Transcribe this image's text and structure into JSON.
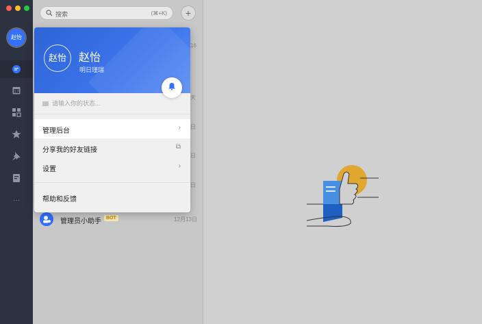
{
  "sidebar": {
    "avatar_text": "赵怡",
    "items": [
      {
        "name": "chat-icon",
        "active": true
      },
      {
        "name": "calendar-icon"
      },
      {
        "name": "apps-icon"
      },
      {
        "name": "star-icon"
      },
      {
        "name": "pin-icon"
      },
      {
        "name": "docs-icon"
      },
      {
        "name": "more-icon",
        "glyph": "···"
      }
    ]
  },
  "search": {
    "placeholder": "搜索",
    "hotkey": "(⌘+K)"
  },
  "list": {
    "bot_row": {
      "avatar": "",
      "name": "管理员小助手",
      "badge": "BOT",
      "time": "12月13日"
    },
    "partial_labels": [
      "16",
      "天",
      "日",
      "日",
      "日"
    ]
  },
  "profile_popup": {
    "avatar_text": "赵怡",
    "name": "赵怡",
    "org": "明日瑾瑞",
    "status_placeholder": "请输入你的状态...",
    "menu": [
      {
        "label": "管理后台",
        "tail": "›",
        "highlight": true
      },
      {
        "label": "分享我的好友链接",
        "tail": "⧉"
      },
      {
        "label": "设置",
        "tail": "›"
      },
      {
        "label": "帮助和反馈",
        "tail": ""
      }
    ]
  },
  "colors": {
    "accent": "#3370ff",
    "sidebar_bg": "#2c3240",
    "popup_header": "#3d75ec",
    "illustration_yellow": "#e0a830"
  }
}
